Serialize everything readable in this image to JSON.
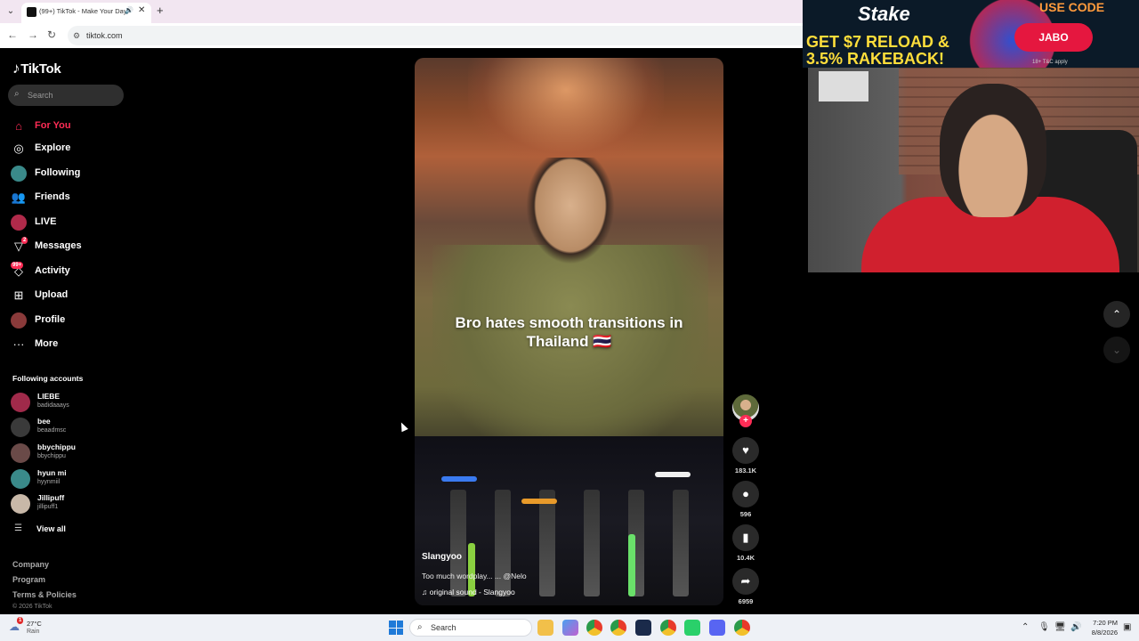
{
  "browser": {
    "tab_title": "(99+) TikTok - Make Your Day",
    "url": "tiktok.com"
  },
  "sidebar": {
    "logo": "TikTok",
    "search_placeholder": "Search",
    "nav": [
      {
        "label": "For You",
        "icon": "home-icon",
        "active": true
      },
      {
        "label": "Explore",
        "icon": "compass-icon"
      },
      {
        "label": "Following",
        "icon": "following-avatar-icon"
      },
      {
        "label": "Friends",
        "icon": "friends-icon"
      },
      {
        "label": "LIVE",
        "icon": "live-icon"
      },
      {
        "label": "Messages",
        "icon": "send-icon",
        "badge": "2"
      },
      {
        "label": "Activity",
        "icon": "activity-icon",
        "badge": "99+"
      },
      {
        "label": "Upload",
        "icon": "upload-icon"
      },
      {
        "label": "Profile",
        "icon": "profile-avatar-icon"
      },
      {
        "label": "More",
        "icon": "more-icon"
      }
    ],
    "following_title": "Following accounts",
    "accounts": [
      {
        "name": "LIEBE",
        "handle": "badidaaays"
      },
      {
        "name": "bee",
        "handle": "beaadmsc"
      },
      {
        "name": "bbychippu",
        "handle": "bbychippu"
      },
      {
        "name": "hyun mi",
        "handle": "hyynmiil"
      },
      {
        "name": "Jillipuff",
        "handle": "jillipuff1"
      }
    ],
    "view_all": "View all",
    "footer": [
      "Company",
      "Program",
      "Terms & Policies"
    ],
    "copyright": "© 2026 TikTok"
  },
  "video": {
    "caption": "Bro hates smooth transitions in Thailand 🇹🇭",
    "author": "Slangyoo",
    "description": "Too much wordplay... ... @Nelo",
    "sound": "original sound - Slangyoo",
    "likes": "183.1K",
    "comments": "596",
    "saves": "10.4K",
    "shares": "6959"
  },
  "ad": {
    "brand": "Stake",
    "headline": "GET $7 RELOAD & 3.5% RAKEBACK!",
    "use_code": "USE CODE",
    "code": "JABO",
    "legal": "18+ T&C apply"
  },
  "taskbar": {
    "temperature": "27°C",
    "condition": "Rain",
    "weather_badge": "1",
    "search": "Search",
    "time": "7:20 PM",
    "date": "8/8/2026"
  },
  "colors": {
    "accent": "#fe2c55",
    "background": "#000000"
  }
}
